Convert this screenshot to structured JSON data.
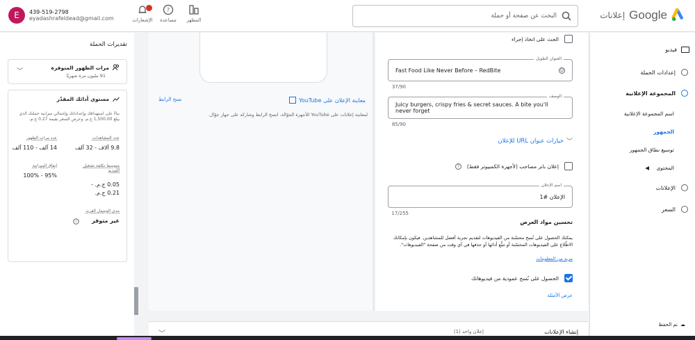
{
  "header": {
    "brand_google": "Google",
    "brand_product": "إعلانات",
    "search_placeholder": "البحث عن صفحة أو حملة",
    "icons": [
      {
        "name": "appearance",
        "label": "المظهر"
      },
      {
        "name": "help",
        "label": "مساعدة"
      },
      {
        "name": "notifications",
        "label": "الإشعارات",
        "badge": "!"
      }
    ],
    "account": {
      "avatar_letter": "E",
      "phone": "439-519-2798",
      "email": "eyadashrafeldead@gmail.com"
    }
  },
  "nav": {
    "video_label": "فيديو",
    "items": [
      {
        "label": "إعدادات الحملة",
        "active": false
      },
      {
        "label": "المجموعة الإعلانية",
        "active": true
      },
      {
        "label": "الإعلانات",
        "active": false
      },
      {
        "label": "السعر",
        "active": false
      }
    ],
    "subitems": [
      "اسم المجموعة الإعلانية",
      "الجمهور",
      "توسيع نطاق الجمهور",
      "المحتوى"
    ],
    "selected_sub": "الجمهور",
    "saved": "تم الحفظ"
  },
  "preview": {
    "youtube_link": "معاينة الإعلان على YouTube",
    "copy_link": "نسخ الرابط",
    "note": "لمعاينة إعلانات على YouTube للأجهزة الجوّالة، انسخ الرابط وشاركه على جهاز جوّال."
  },
  "form": {
    "cta_checkbox": "الحث على اتخاذ إجراء",
    "long_headline": {
      "label": "العنوان الطويل",
      "value": "Fast Food Like Never Before – RedBite",
      "counter": "37/90"
    },
    "description": {
      "label": "الوصف",
      "value": "Juicy burgers, crispy fries & secret sauces. A bite you'll never forget",
      "counter": "85/90"
    },
    "url_options": "خيارات عنوان URL للإعلان",
    "companion_banner": "إعلان بانر مصاحب (لأجهزة الكمبيوتر فقط)",
    "ad_name": {
      "label": "اسم الإعلان",
      "value": "الإعلان #1",
      "counter": "17/255"
    },
    "section_title": "تحسين مواد العرض",
    "section_desc": "يمكنك الحصول على نُسخ محسّنة من الفيديوهات لتقديم تجربة أفضل للمشاهدين. فيكون بإمكانك الاطّلاع على الفيديوهات المحسّنة أو تتبُّع أدائها أو حذفها في أي وقت من صفحة \"الفيديوهات\".",
    "learn_more": "مزيد من المعلومات",
    "vertical_checkbox": "الحصول على نُسخ عمودية من فيديوهاتك",
    "examples": "عرض الأمثلة"
  },
  "bottom": {
    "title": "إنشاء الإعلانات",
    "subtitle": "إعلان واحد (1)"
  },
  "estimates": {
    "title": "تقديرات الحملة",
    "impressions_card": {
      "title": "مرات الظهور المتوفرة",
      "sub": "91 مليون مرة شهريًا"
    },
    "perf_card": {
      "title": "مستوى أدائك المقدّر",
      "desc": "بناءً على استهدافك وإعداداتك وإجمالي ميزانية حملتك الذي يبلغ 1,500.00 ج.م. وعرض السعر بقيمة 0.27 ج.م.",
      "views_label": "عدد المشاهدات",
      "views_value": "9.8 آلاف - 32 آلف",
      "impr_label": "عدد مرات الظهور",
      "impr_value": "14 آلف - 110 آلف",
      "avg_cpv_label": "متوسط تكلفة تشغيل الفيديو",
      "avg_cpv_value": "0.05 ج.م. - 0.21 ج.م.",
      "budget_spend_label": "إنفاق الميزانية",
      "budget_spend_value": "95% - 100%",
      "reach_label": "مدى الوصول الفريد",
      "reach_value": "غير متوفر"
    }
  }
}
